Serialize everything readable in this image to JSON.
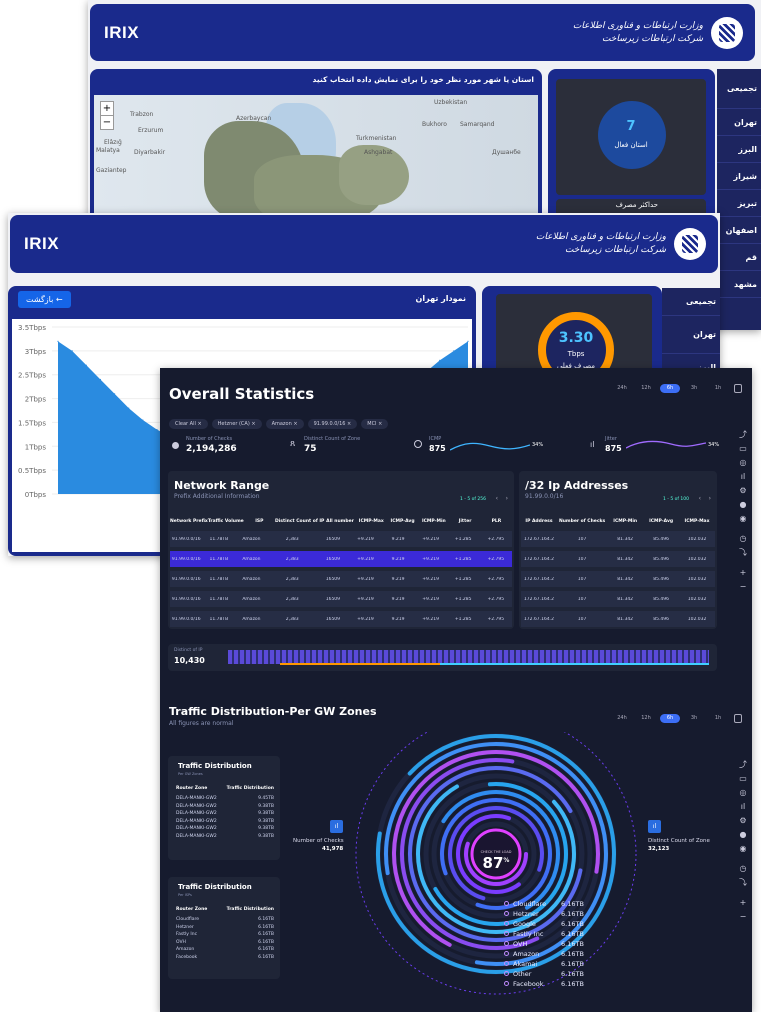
{
  "window1": {
    "brand": "IRIX",
    "logo_text_line1": "وزارت ارتباطات و فناوری اطلاعات",
    "logo_text_line2": "شرکت ارتباطات زیرساخت",
    "map_title": "استان یا شهر مورد نظر خود را برای نمایش داده انتخاب کنید",
    "sidebar": [
      "تجمیعی",
      "تهران",
      "البرز",
      "شیراز",
      "تبریز",
      "اصفهان",
      "قم",
      "مشهد"
    ],
    "stat_value": "7",
    "stat_label": "استان فعال",
    "stat2_label": "حداکثر مصرف",
    "map_labels": [
      "Trabzon",
      "Erzurum",
      "Azerbaycan",
      "Uzbekistan",
      "Turkmenistan",
      "Bukhoro",
      "Samarqand",
      "Ashgabat",
      "Diyarbakir",
      "Malatya",
      "Gaziantep",
      "Elâzığ",
      "Душанбе"
    ],
    "zoom_in": "+",
    "zoom_out": "−"
  },
  "window2": {
    "brand": "IRIX",
    "logo_text_line1": "وزارت ارتباطات و فناوری اطلاعات",
    "logo_text_line2": "شرکت ارتباطات زیرساخت",
    "chart_title": "نمودار تهران",
    "back_button": "بازگشت ←",
    "sidebar": [
      "تجمیعی",
      "تهران",
      "البرز"
    ],
    "gauge_value": "3.30",
    "gauge_unit": "Tbps",
    "gauge_label": "مصرف فعلی"
  },
  "chart_data": {
    "type": "area",
    "title": "نمودار تهران",
    "ylabel": "",
    "yticks": [
      "0Tbps",
      "0.5Tbps",
      "1Tbps",
      "1.5Tbps",
      "2Tbps",
      "2.5Tbps",
      "3Tbps",
      "3.5Tbps"
    ],
    "ylim": [
      0,
      3.5
    ],
    "series": [
      {
        "values": [
          3.2,
          3.0,
          2.7,
          2.4,
          2.1,
          1.8,
          1.55,
          1.35,
          1.2,
          1.1,
          1.0,
          1.0,
          1.05,
          1.1,
          1.2,
          1.3,
          1.4,
          1.6,
          1.9,
          2.2,
          2.4,
          2.3,
          2.15,
          2.1,
          2.2,
          2.35,
          2.55,
          2.8,
          3.0,
          3.2
        ]
      }
    ],
    "color": "#2a8be0"
  },
  "window3": {
    "title": "Overall Statistics",
    "filters": [
      "Clear All ×",
      "Hetzner (CA) ×",
      "Amazon ×",
      "91.99.0.0/16 ×",
      "MCI ×"
    ],
    "time_tabs": [
      "24h",
      "12h",
      "6h",
      "3h",
      "1h"
    ],
    "time_active": "6h",
    "kpis": [
      {
        "label": "Number of Checks",
        "value": "2,194,286"
      },
      {
        "label": "Distinct Count of Zone",
        "value": "75"
      },
      {
        "label": "ICMP",
        "value": "875",
        "pct": "34%"
      },
      {
        "label": "Jitter",
        "value": "875",
        "pct": "34%"
      }
    ],
    "network": {
      "title": "Network Range",
      "subtitle": "Prefix Additional Information",
      "pager": "1 - 5 of 256",
      "columns": [
        "Network Prefix",
        "Traffic Volume",
        "ISP",
        "Distinct Count of IP",
        "All number",
        "ICMP-Max",
        "ICMP-Avg",
        "ICMP-Min",
        "Jitter",
        "PLR"
      ],
      "rows": [
        [
          "91.99.0.0/16",
          "11.78TB",
          "Amazon",
          "2,383",
          "16509",
          "+9.219",
          "9.219",
          "+9.219",
          "+1.285",
          "+2.795"
        ],
        [
          "91.99.0.0/16",
          "11.78TB",
          "Amazon",
          "2,383",
          "16509",
          "+9.219",
          "9.219",
          "+9.219",
          "+1.285",
          "+2.795"
        ],
        [
          "91.99.0.0/16",
          "11.78TB",
          "Amazon",
          "2,383",
          "16509",
          "+9.219",
          "9.219",
          "+9.219",
          "+1.285",
          "+2.795"
        ],
        [
          "91.99.0.0/16",
          "11.78TB",
          "Amazon",
          "2,383",
          "16509",
          "+9.219",
          "9.219",
          "+9.219",
          "+1.285",
          "+2.795"
        ],
        [
          "91.99.0.0/16",
          "11.78TB",
          "Amazon",
          "2,383",
          "16509",
          "+9.219",
          "9.219",
          "+9.219",
          "+1.285",
          "+2.795"
        ]
      ]
    },
    "ip32": {
      "title": "/32 Ip Addresses",
      "subtitle": "91.99.0.0/16",
      "pager": "1 - 5 of 100",
      "columns": [
        "IP Address",
        "Number of Checks",
        "ICMP-Min",
        "ICMP-Avg",
        "ICMP-Max"
      ],
      "rows": [
        [
          "172.67.164.2",
          "107",
          "81.342",
          "85.496",
          "102.032"
        ],
        [
          "172.67.164.2",
          "107",
          "81.342",
          "85.496",
          "102.032"
        ],
        [
          "172.67.164.2",
          "107",
          "81.342",
          "85.496",
          "102.032"
        ],
        [
          "172.67.164.2",
          "107",
          "81.342",
          "85.496",
          "102.032"
        ],
        [
          "172.67.164.2",
          "107",
          "81.342",
          "85.496",
          "102.032"
        ]
      ]
    },
    "distinct": {
      "label": "Distinct of IP",
      "value": "10,430"
    },
    "traffic": {
      "title": "Traffic Distribution-Per GW Zones",
      "subtitle": "All figures are normal",
      "center_label": "CHECK THE LOAD",
      "center_value": "87",
      "center_unit": "%",
      "left_label": "Number of Checks",
      "left_value": "41,978",
      "right_label": "Distinct Count of Zone",
      "right_value": "32,123",
      "card1": {
        "title": "Traffic Distribution",
        "sub": "Per GW Zones",
        "cols": [
          "Router Zone",
          "Traffic Distribution"
        ],
        "rows": [
          [
            "DELA-MANKI-GW2",
            "9.45TB"
          ],
          [
            "DELA-MANKI-GW2",
            "9.38TB"
          ],
          [
            "DELA-MANKI-GW2",
            "9.38TB"
          ],
          [
            "DELA-MANKI-GW2",
            "9.38TB"
          ],
          [
            "DELA-MANKI-GW2",
            "9.38TB"
          ],
          [
            "DELA-MANKI-GW2",
            "9.38TB"
          ]
        ]
      },
      "card2": {
        "title": "Traffic Distribution",
        "sub": "Per ISPs",
        "cols": [
          "Router Zone",
          "Traffic Distribution"
        ],
        "rows": [
          [
            "Cloudflare",
            "6.16TB"
          ],
          [
            "Hetzner",
            "6.16TB"
          ],
          [
            "Fastly Inc",
            "6.16TB"
          ],
          [
            "OVH",
            "6.16TB"
          ],
          [
            "Amazon",
            "6.16TB"
          ],
          [
            "Facebook",
            "6.16TB"
          ]
        ]
      },
      "legend": [
        [
          "Cloudflare",
          "6.16TB"
        ],
        [
          "Hetzner",
          "6.16TB"
        ],
        [
          "Google",
          "6.16TB"
        ],
        [
          "Fastly Inc",
          "6.16TB"
        ],
        [
          "OVH",
          "6.16TB"
        ],
        [
          "Amazon",
          "6.16TB"
        ],
        [
          "Akamai",
          "6.16TB"
        ],
        [
          "Other",
          "6.16TB"
        ],
        [
          "Facebook",
          "6.16TB"
        ]
      ]
    }
  }
}
